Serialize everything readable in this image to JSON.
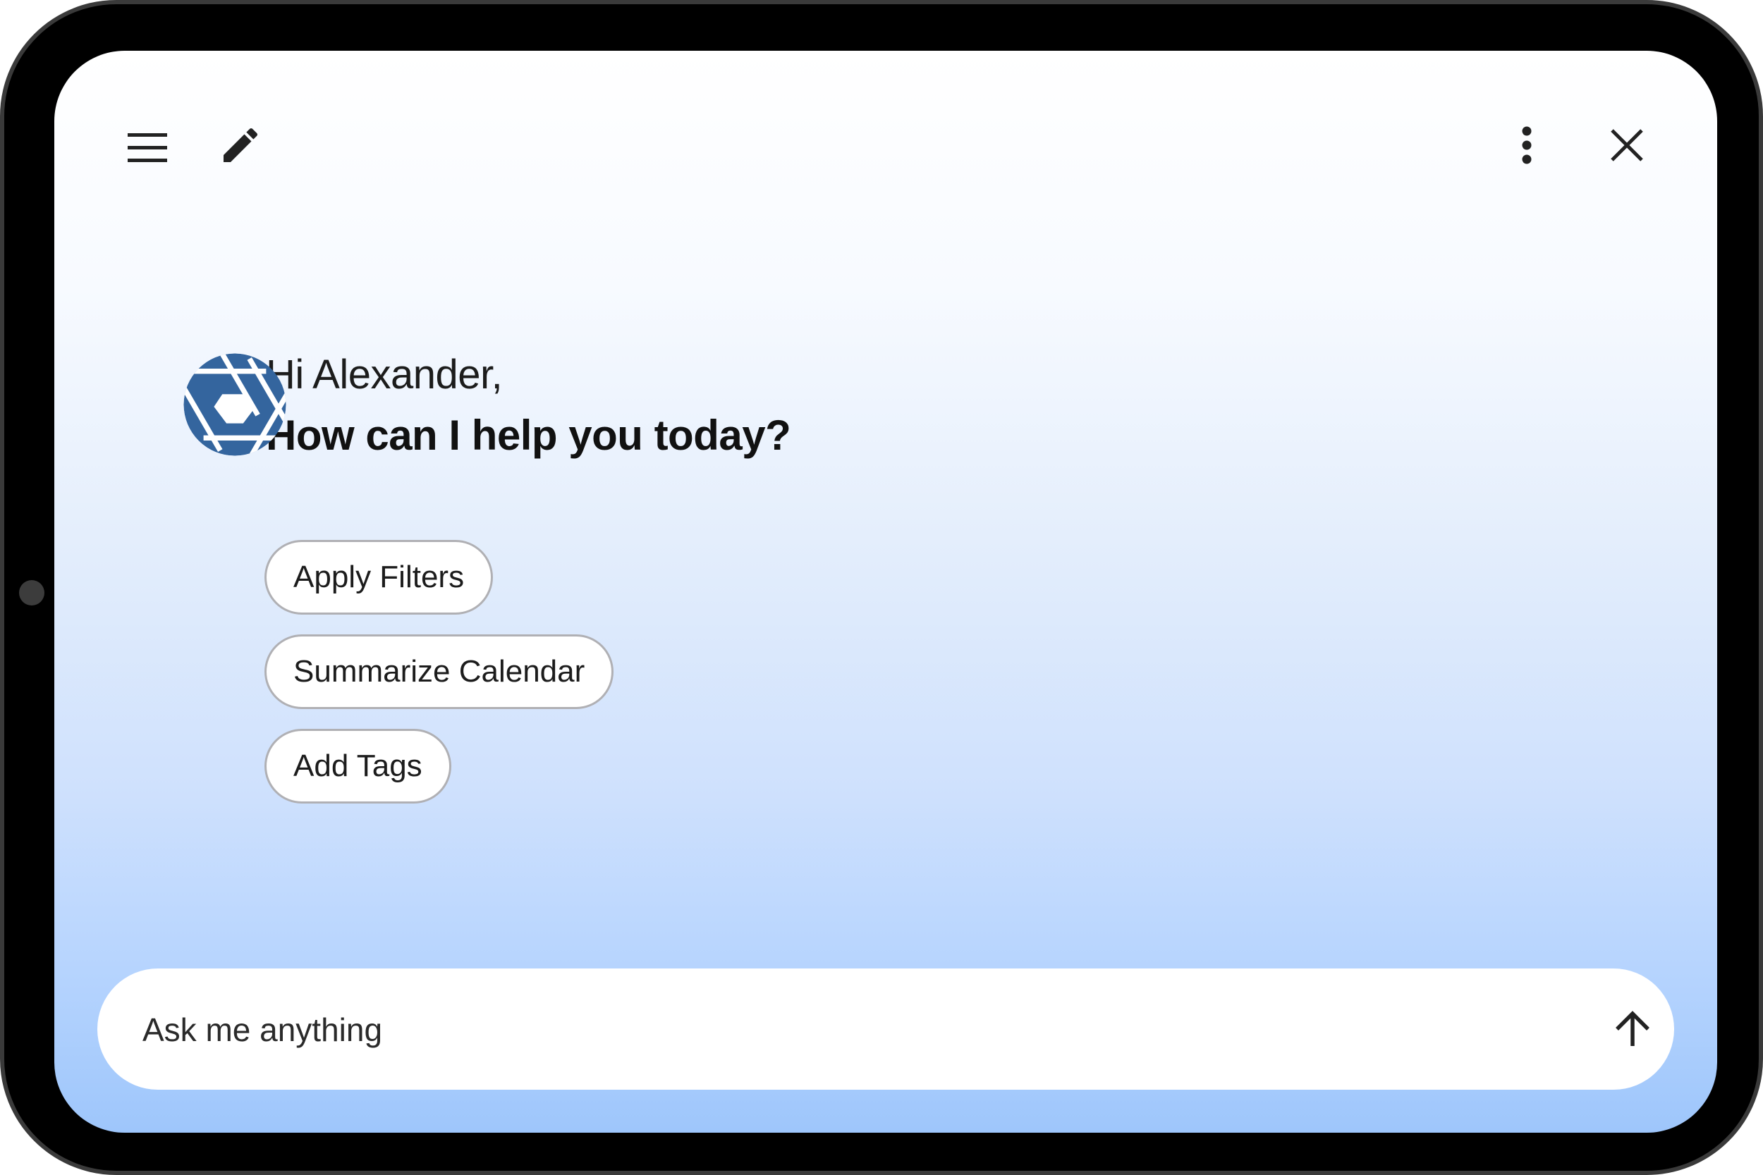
{
  "header": {
    "menu_icon": "hamburger-menu-icon",
    "new_chat_icon": "pencil-icon",
    "more_icon": "vertical-dots-icon",
    "close_icon": "close-x-icon"
  },
  "greeting": {
    "hello": "Hi Alexander,",
    "prompt": "How can I help you today?",
    "avatar_icon": "aperture-icon"
  },
  "suggestions": [
    {
      "label": "Apply Filters"
    },
    {
      "label": "Summarize Calendar"
    },
    {
      "label": "Add Tags"
    }
  ],
  "input": {
    "placeholder": "Ask me anything",
    "value": "",
    "send_icon": "arrow-up-icon"
  },
  "colors": {
    "accent": "#34659e",
    "frame": "#000000",
    "gradient_top": "#ffffff",
    "gradient_bottom": "#9ec6fb",
    "chip_border": "#b0b0b4"
  }
}
